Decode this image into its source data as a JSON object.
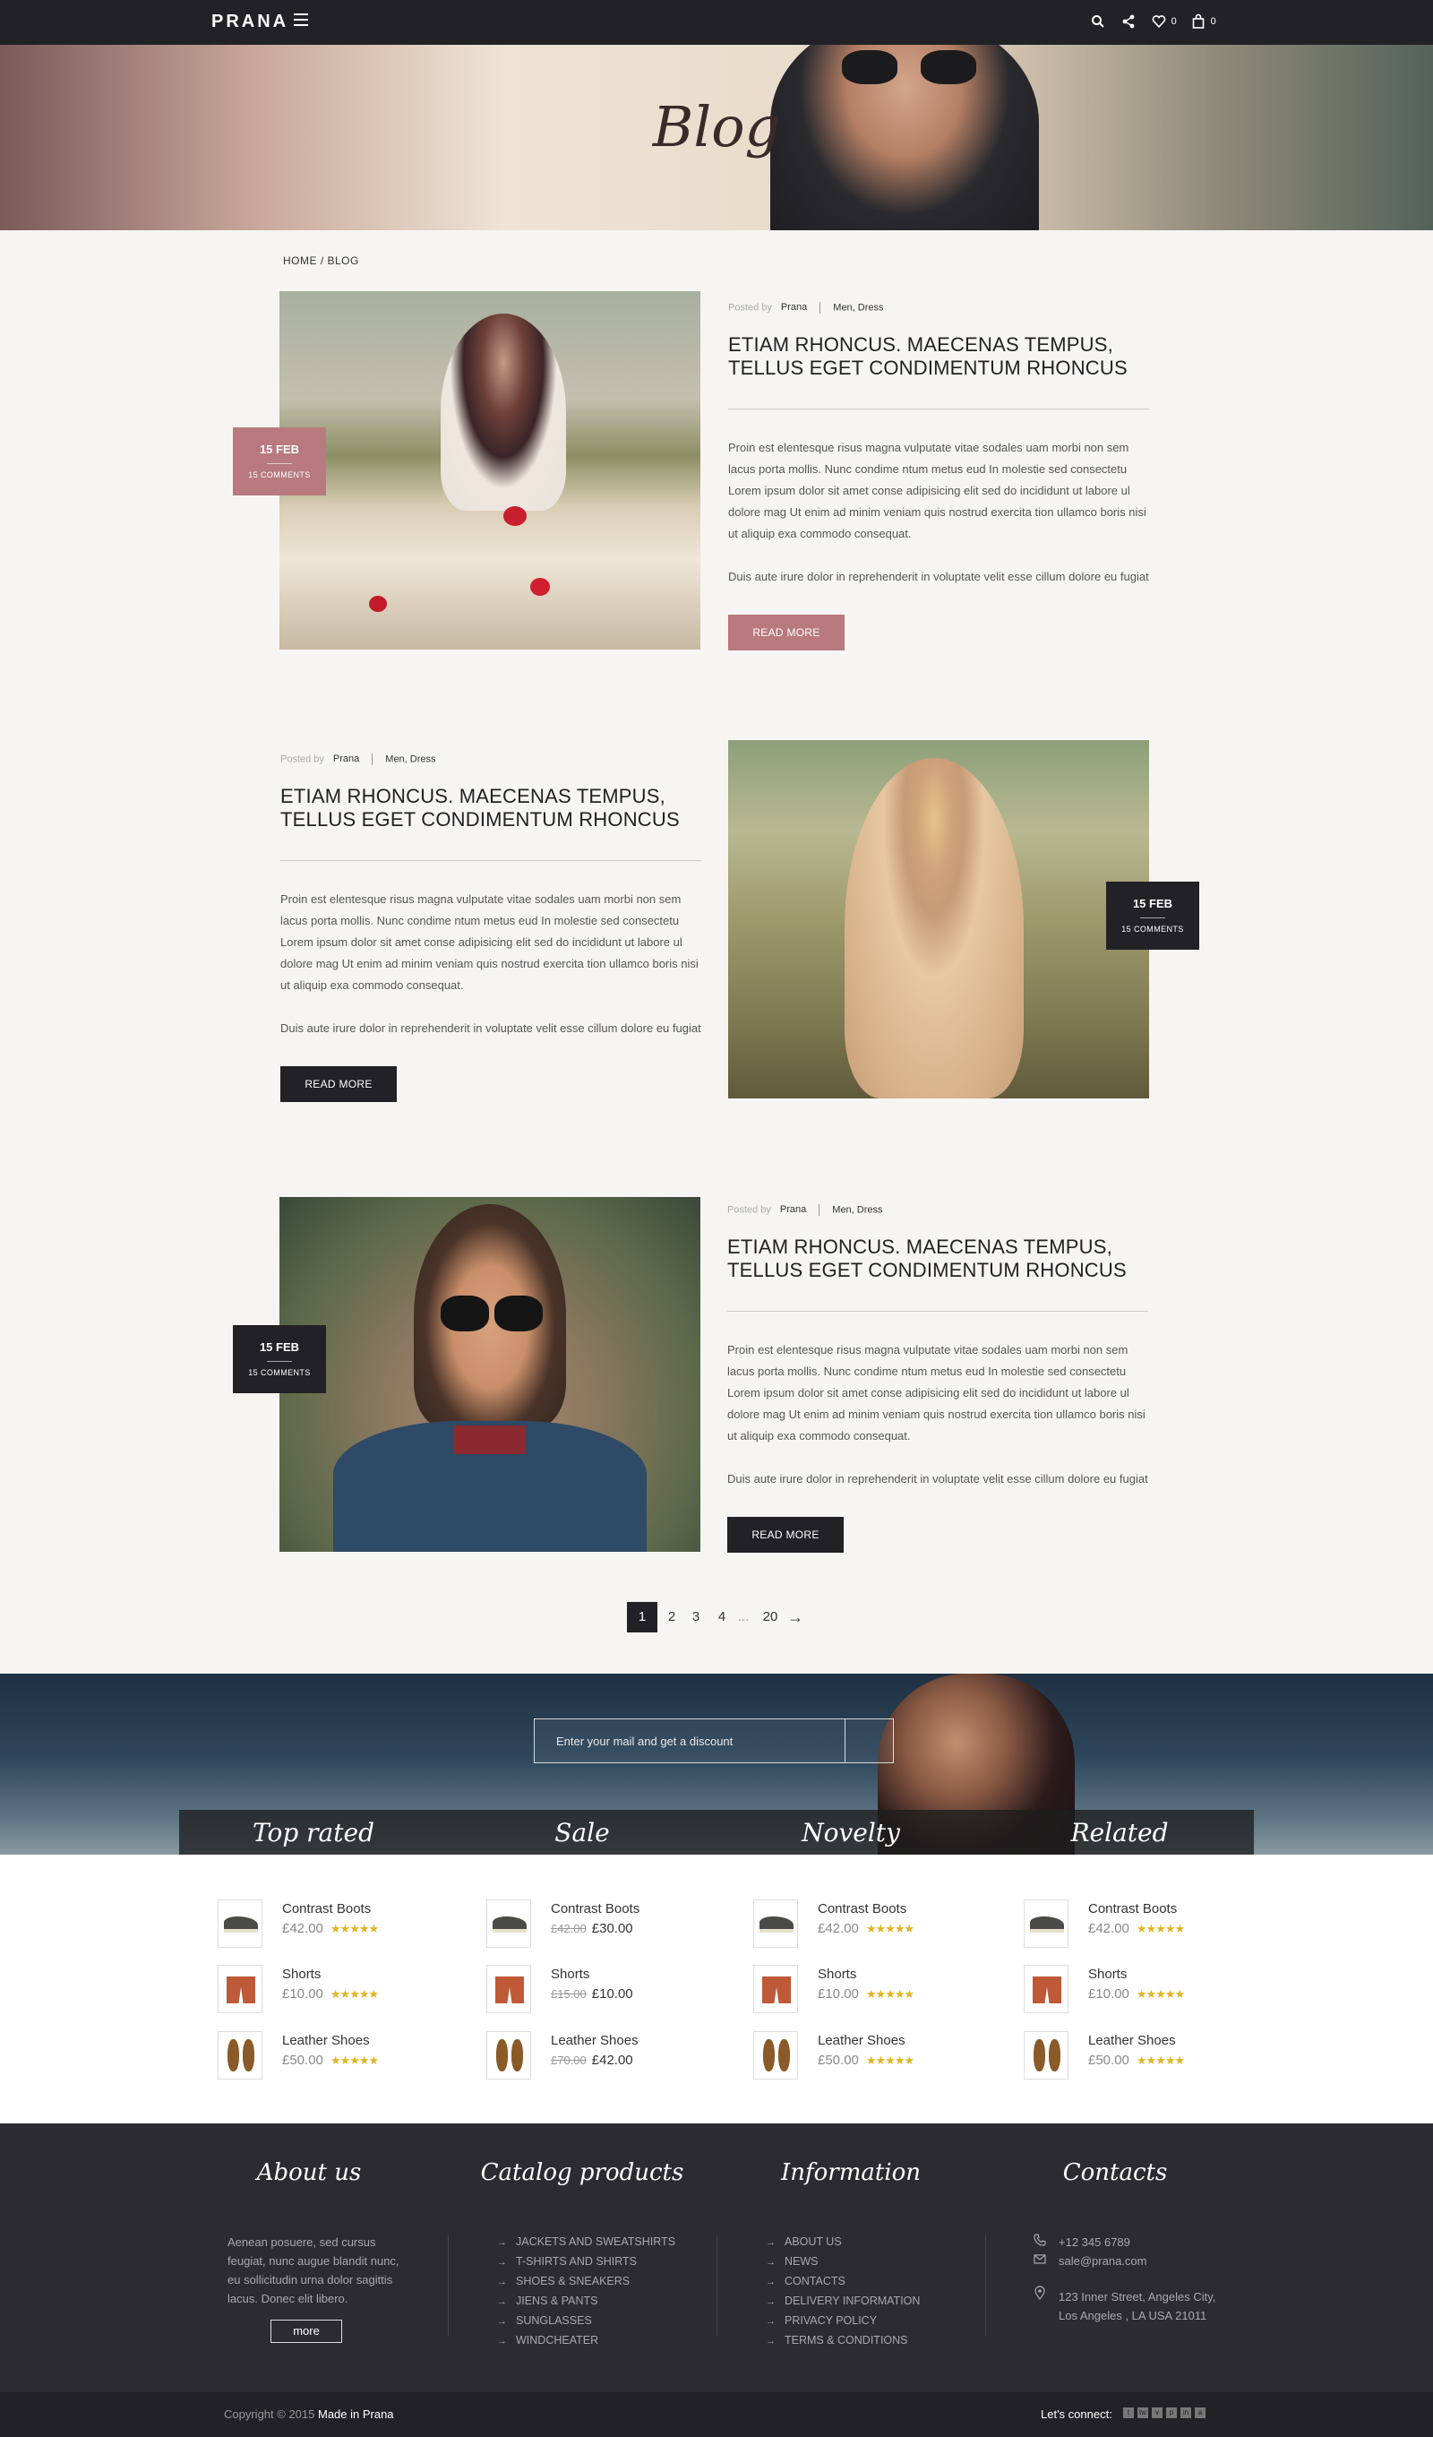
{
  "header": {
    "logo": "PRANA",
    "wishlist_count": "0",
    "cart_count": "0"
  },
  "hero": {
    "title": "Blog"
  },
  "breadcrumb": {
    "text": "HOME / BLOG"
  },
  "posts": [
    {
      "day": "15 FEB",
      "comments": "15 COMMENTS",
      "posted_by_label": "Posted by",
      "author": "Prana",
      "tags": "Men, Dress",
      "title": "ETIAM RHONCUS. MAECENAS TEMPUS, TELLUS EGET CONDIMENTUM RHONCUS",
      "excerpt1": "Proin est elentesque risus magna vulputate vitae sodales uam morbi non sem lacus porta mollis. Nunc condime ntum metus eud In molestie sed consectetu Lorem ipsum dolor sit amet conse adipisicing elit sed do incididunt ut labore ul dolore mag Ut enim ad minim veniam quis nostrud exercita tion ullamco boris nisi ut aliquip exa commodo consequat.",
      "excerpt2": "Duis aute irure dolor in reprehenderit in voluptate velit esse cillum dolore eu fugiat",
      "button": "READ MORE"
    },
    {
      "day": "15 FEB",
      "comments": "15 COMMENTS",
      "posted_by_label": "Posted by",
      "author": "Prana",
      "tags": "Men, Dress",
      "title": "ETIAM RHONCUS. MAECENAS TEMPUS, TELLUS EGET CONDIMENTUM RHONCUS",
      "excerpt1": "Proin est elentesque risus magna vulputate vitae sodales uam morbi non sem lacus porta mollis. Nunc condime ntum metus eud In molestie sed consectetu Lorem ipsum dolor sit amet conse adipisicing elit sed do incididunt ut labore ul dolore mag Ut enim ad minim veniam quis nostrud exercita tion ullamco boris nisi ut aliquip exa commodo consequat.",
      "excerpt2": "Duis aute irure dolor in reprehenderit in voluptate velit esse cillum dolore eu fugiat",
      "button": "READ MORE"
    },
    {
      "day": "15 FEB",
      "comments": "15 COMMENTS",
      "posted_by_label": "Posted by",
      "author": "Prana",
      "tags": "Men, Dress",
      "title": "ETIAM RHONCUS. MAECENAS TEMPUS, TELLUS EGET CONDIMENTUM RHONCUS",
      "excerpt1": "Proin est elentesque risus magna vulputate vitae sodales uam morbi non sem lacus porta mollis. Nunc condime ntum metus eud In molestie sed consectetu Lorem ipsum dolor sit amet conse adipisicing elit sed do incididunt ut labore ul dolore mag Ut enim ad minim veniam quis nostrud exercita tion ullamco boris nisi ut aliquip exa commodo consequat.",
      "excerpt2": "Duis aute irure dolor in reprehenderit in voluptate velit esse cillum dolore eu fugiat",
      "button": "READ MORE"
    }
  ],
  "pagination": {
    "pages": [
      "1",
      "2",
      "3",
      "4",
      "...",
      "20"
    ],
    "current": "1",
    "next": "→"
  },
  "subscribe": {
    "placeholder": "Enter your mail and get a discount"
  },
  "product_tabs": [
    "Top rated",
    "Sale",
    "Novelty",
    "Related"
  ],
  "product_columns": [
    [
      {
        "name": "Contrast Boots",
        "price": "£42.00",
        "old": "",
        "rating": 5,
        "kind": "boots"
      },
      {
        "name": "Shorts",
        "price": "£10.00",
        "old": "",
        "rating": 5,
        "kind": "shorts"
      },
      {
        "name": "Leather Shoes",
        "price": "£50.00",
        "old": "",
        "rating": 5,
        "kind": "shoes"
      }
    ],
    [
      {
        "name": "Contrast Boots",
        "price": "£30.00",
        "old": "£42.00",
        "rating": 0,
        "kind": "boots"
      },
      {
        "name": "Shorts",
        "price": "£10.00",
        "old": "£15.00",
        "rating": 0,
        "kind": "shorts"
      },
      {
        "name": "Leather Shoes",
        "price": "£42.00",
        "old": "£70.00",
        "rating": 0,
        "kind": "shoes"
      }
    ],
    [
      {
        "name": "Contrast Boots",
        "price": "£42.00",
        "old": "",
        "rating": 5,
        "kind": "boots"
      },
      {
        "name": "Shorts",
        "price": "£10.00",
        "old": "",
        "rating": 5,
        "kind": "shorts"
      },
      {
        "name": "Leather Shoes",
        "price": "£50.00",
        "old": "",
        "rating": 5,
        "kind": "shoes"
      }
    ],
    [
      {
        "name": "Contrast Boots",
        "price": "£42.00",
        "old": "",
        "rating": 5,
        "kind": "boots"
      },
      {
        "name": "Shorts",
        "price": "£10.00",
        "old": "",
        "rating": 5,
        "kind": "shorts"
      },
      {
        "name": "Leather Shoes",
        "price": "£50.00",
        "old": "",
        "rating": 5,
        "kind": "shoes"
      }
    ]
  ],
  "footer": {
    "about": {
      "title": "About us",
      "text": "Aenean posuere, sed cursus feugiat, nunc augue blandit nunc, eu sollicitudin urna dolor sagittis lacus. Donec elit libero.",
      "more": "more"
    },
    "catalog": {
      "title": "Catalog products",
      "items": [
        "JACKETS AND SWEATSHIRTS",
        "T-SHIRTS AND SHIRTS",
        "SHOES & SNEAKERS",
        "JIENS & PANTS",
        "SUNGLASSES",
        "WINDCHEATER"
      ]
    },
    "information": {
      "title": "Information",
      "items": [
        "ABOUT US",
        "NEWS",
        "CONTACTS",
        "DELIVERY INFORMATION",
        "PRIVACY POLICY",
        "TERMS & CONDITIONS"
      ]
    },
    "contacts": {
      "title": "Contacts",
      "phone": "+12 345 6789",
      "email": "sale@prana.com",
      "address_line1": "123 Inner Street, Angeles City,",
      "address_line2": "Los Angeles , LA USA 21011"
    }
  },
  "bottom": {
    "copyright": "Copyright © 2015",
    "made_in": "Made in Prana",
    "connect": "Let's connect:",
    "social": [
      "t",
      "tw",
      "v",
      "p",
      "in",
      "a"
    ]
  },
  "colors": {
    "accent": "#b87a7e",
    "dark": "#222226",
    "star": "#e0b422"
  }
}
